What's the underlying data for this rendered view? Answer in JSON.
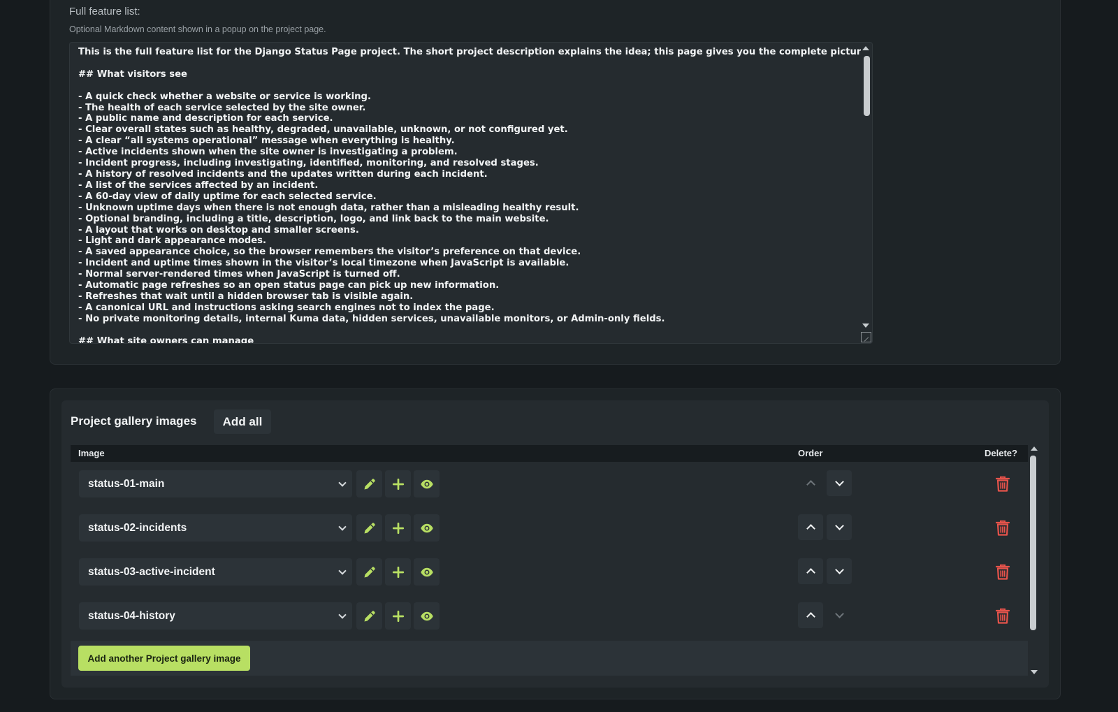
{
  "feature_field": {
    "label": "Full feature list:",
    "help": "Optional Markdown content shown in a popup on the project page.",
    "value": "This is the full feature list for the Django Status Page project. The short project description explains the idea; this page gives you the complete picture.\n\n## What visitors see\n\n- A quick check whether a website or service is working.\n- The health of each service selected by the site owner.\n- A public name and description for each service.\n- Clear overall states such as healthy, degraded, unavailable, unknown, or not configured yet.\n- A clear “all systems operational” message when everything is healthy.\n- Active incidents shown when the site owner is investigating a problem.\n- Incident progress, including investigating, identified, monitoring, and resolved stages.\n- A history of resolved incidents and the updates written during each incident.\n- A list of the services affected by an incident.\n- A 60-day view of daily uptime for each selected service.\n- Unknown uptime days when there is not enough data, rather than a misleading healthy result.\n- Optional branding, including a title, description, logo, and link back to the main website.\n- A layout that works on desktop and smaller screens.\n- Light and dark appearance modes.\n- A saved appearance choice, so the browser remembers the visitor’s preference on that device.\n- Incident and uptime times shown in the visitor’s local timezone when JavaScript is available.\n- Normal server-rendered times when JavaScript is turned off.\n- Automatic page refreshes so an open status page can pick up new information.\n- Refreshes that wait until a hidden browser tab is visible again.\n- A canonical URL and instructions asking search engines not to index the page.\n- No private monitoring details, internal Kuma data, hidden services, unavailable monitors, or Admin-only fields.\n\n## What site owners can manage"
  },
  "gallery": {
    "title": "Project gallery images",
    "add_all": "Add all",
    "columns": {
      "image": "Image",
      "order": "Order",
      "delete": "Delete?"
    },
    "rows": [
      {
        "image": "status-01-main",
        "up_enabled": false,
        "down_enabled": true
      },
      {
        "image": "status-02-incidents",
        "up_enabled": true,
        "down_enabled": true
      },
      {
        "image": "status-03-active-incident",
        "up_enabled": true,
        "down_enabled": true
      },
      {
        "image": "status-04-history",
        "up_enabled": true,
        "down_enabled": false
      }
    ],
    "add_another": "Add another Project gallery image"
  },
  "icons": {
    "edit": "pencil-icon",
    "add": "plus-icon",
    "view": "eye-icon",
    "delete": "trash-icon",
    "order_up": "chevron-up-icon",
    "order_down": "chevron-down-icon"
  },
  "colors": {
    "accent": "#b8df63",
    "danger": "#e5534b",
    "background": "#161b1e",
    "panel": "#1e2427"
  }
}
